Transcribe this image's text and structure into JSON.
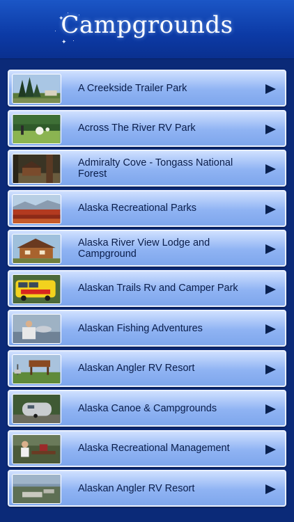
{
  "header": {
    "title": "Campgrounds"
  },
  "items": [
    {
      "label": "A Creekside Trailer Park",
      "thumb_icon": "forest-photo"
    },
    {
      "label": "Across The River RV Park",
      "thumb_icon": "meadow-photo"
    },
    {
      "label": "Admiralty Cove - Tongass National Forest",
      "thumb_icon": "cabin-photo"
    },
    {
      "label": "Alaska Recreational Parks",
      "thumb_icon": "tundra-photo"
    },
    {
      "label": "Alaska River View Lodge and Campground",
      "thumb_icon": "lodge-photo"
    },
    {
      "label": "Alaskan Trails Rv and Camper Park",
      "thumb_icon": "camper-van-photo"
    },
    {
      "label": "Alaskan Fishing Adventures",
      "thumb_icon": "fishing-photo"
    },
    {
      "label": "Alaskan Angler RV Resort",
      "thumb_icon": "resort-sign-photo"
    },
    {
      "label": "Alaska Canoe & Campgrounds",
      "thumb_icon": "airstream-photo"
    },
    {
      "label": "Alaska Recreational Management",
      "thumb_icon": "picnic-photo"
    },
    {
      "label": "Alaskan Angler RV Resort",
      "thumb_icon": "aerial-photo"
    }
  ]
}
